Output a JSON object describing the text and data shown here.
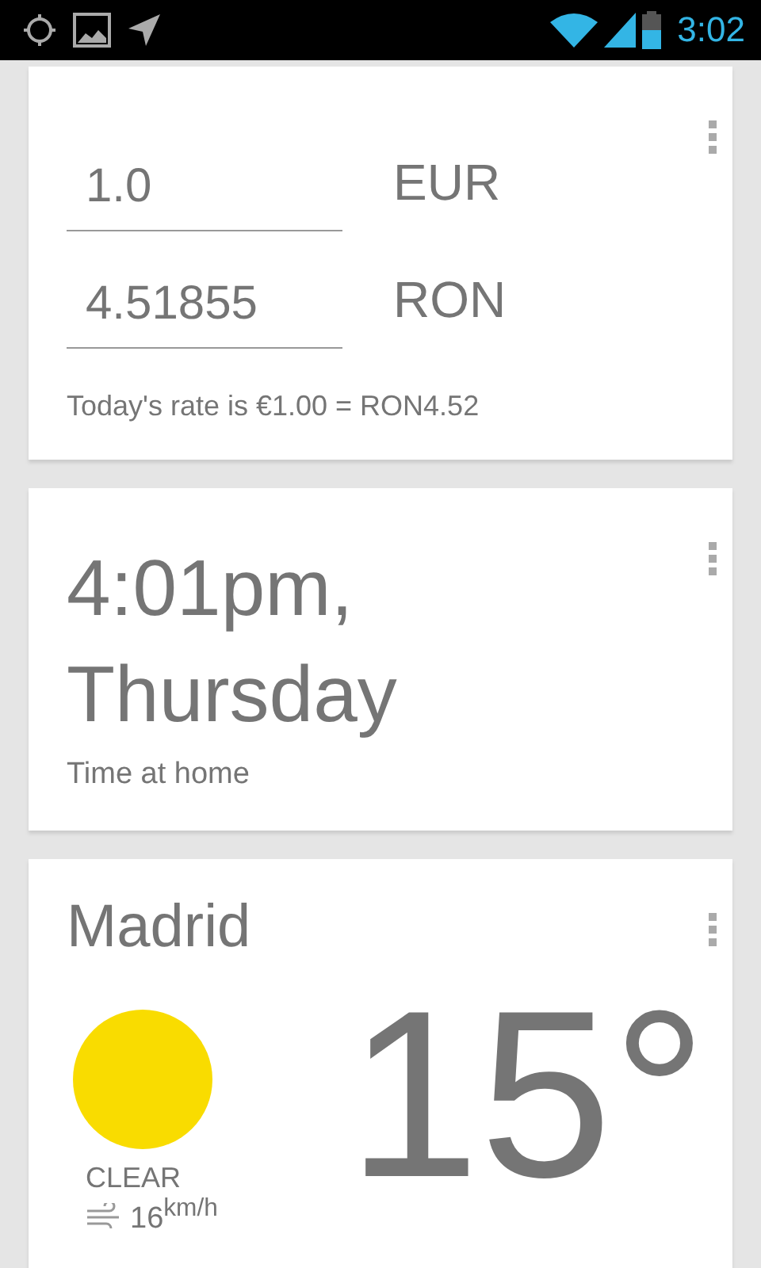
{
  "status_bar": {
    "time": "3:02"
  },
  "currency_card": {
    "rows": [
      {
        "value": "1.0",
        "currency": "EUR"
      },
      {
        "value": "4.51855",
        "currency": "RON"
      }
    ],
    "rate": "Today's rate is €1.00 = RON4.52"
  },
  "time_card": {
    "time": "4:01pm,",
    "day": "Thursday",
    "caption": "Time at home"
  },
  "weather_card": {
    "city": "Madrid",
    "temperature": "15°",
    "condition": "CLEAR",
    "wind": "16$^{km/h}$"
  }
}
